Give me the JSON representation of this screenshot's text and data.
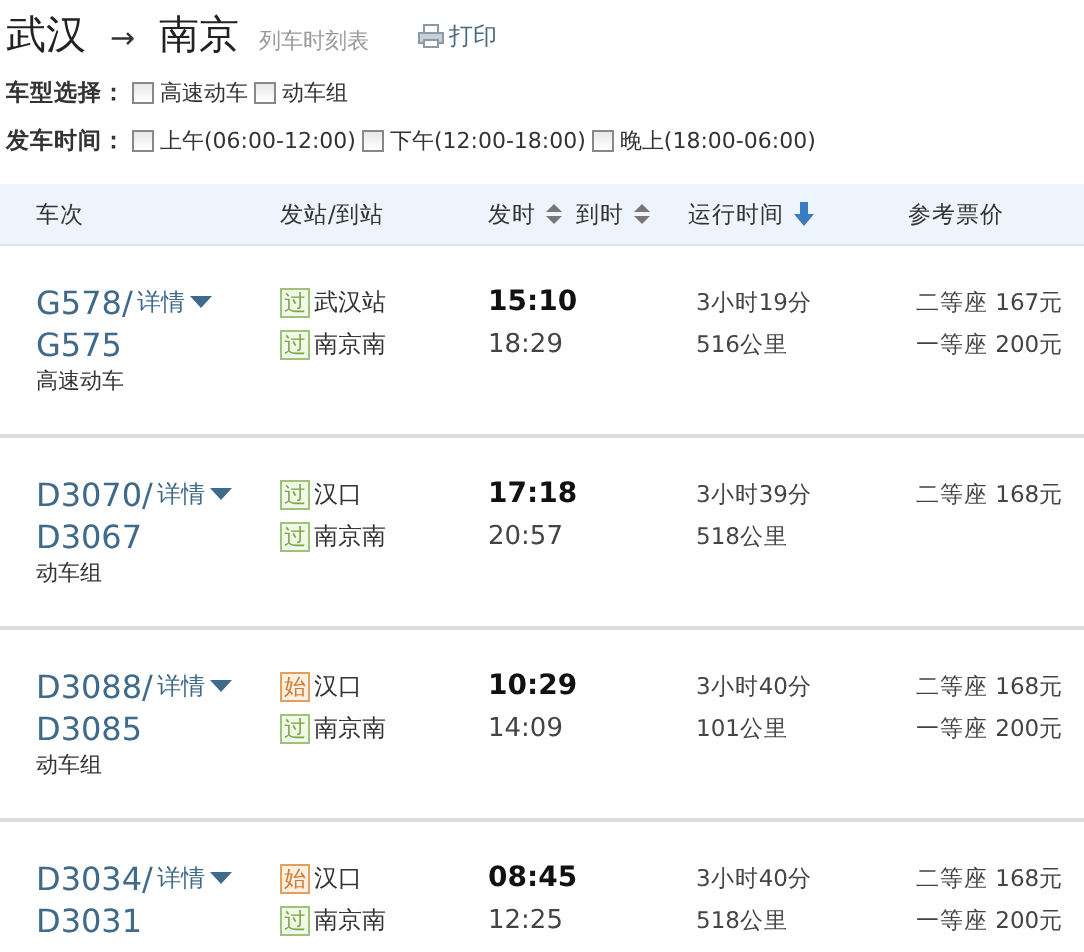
{
  "route": {
    "from": "武汉",
    "arrow": "→",
    "to": "南京",
    "subtitle": "列车时刻表",
    "print": "打印"
  },
  "filters": [
    {
      "label": "车型选择：",
      "options": [
        {
          "label": "高速动车",
          "checked": false
        },
        {
          "label": "动车组",
          "checked": false
        }
      ]
    },
    {
      "label": "发车时间：",
      "options": [
        {
          "label": "上午(06:00-12:00)",
          "checked": false
        },
        {
          "label": "下午(12:00-18:00)",
          "checked": false
        },
        {
          "label": "晚上(18:00-06:00)",
          "checked": false
        }
      ]
    }
  ],
  "columns": [
    {
      "label": "车次",
      "kind": "plain"
    },
    {
      "label": "发站/到站",
      "kind": "plain"
    },
    {
      "label": "发时",
      "kind": "sortable"
    },
    {
      "label": "到时",
      "kind": "sortable"
    },
    {
      "label": "运行时间",
      "kind": "sorted"
    },
    {
      "label": "参考票价",
      "kind": "plain"
    }
  ],
  "rows": [
    {
      "train": "G578/",
      "train2": "G575",
      "details": "详情",
      "type": "高速动车",
      "stations": [
        {
          "kind": "pass",
          "badge": "过",
          "name": "武汉站"
        },
        {
          "kind": "pass",
          "badge": "过",
          "name": "南京南"
        }
      ],
      "depart": "15:10",
      "arrive": "18:29",
      "duration": "3小时19分",
      "distance": "516公里",
      "prices": [
        "二等座 167元",
        "一等座 200元"
      ]
    },
    {
      "train": "D3070/",
      "train2": "D3067",
      "details": "详情",
      "type": "动车组",
      "stations": [
        {
          "kind": "pass",
          "badge": "过",
          "name": "汉口"
        },
        {
          "kind": "pass",
          "badge": "过",
          "name": "南京南"
        }
      ],
      "depart": "17:18",
      "arrive": "20:57",
      "duration": "3小时39分",
      "distance": "518公里",
      "prices": [
        "二等座 168元"
      ]
    },
    {
      "train": "D3088/",
      "train2": "D3085",
      "details": "详情",
      "type": "动车组",
      "stations": [
        {
          "kind": "start",
          "badge": "始",
          "name": "汉口"
        },
        {
          "kind": "pass",
          "badge": "过",
          "name": "南京南"
        }
      ],
      "depart": "10:29",
      "arrive": "14:09",
      "duration": "3小时40分",
      "distance": "101公里",
      "prices": [
        "二等座 168元",
        "一等座 200元"
      ]
    },
    {
      "train": "D3034/",
      "train2": "D3031",
      "details": "详情",
      "stations": [
        {
          "kind": "start",
          "badge": "始",
          "name": "汉口"
        },
        {
          "kind": "pass",
          "badge": "过",
          "name": "南京南"
        }
      ],
      "depart": "08:45",
      "arrive": "12:25",
      "duration": "3小时40分",
      "distance": "518公里",
      "prices": [
        "二等座 168元",
        "一等座 200元"
      ]
    }
  ]
}
